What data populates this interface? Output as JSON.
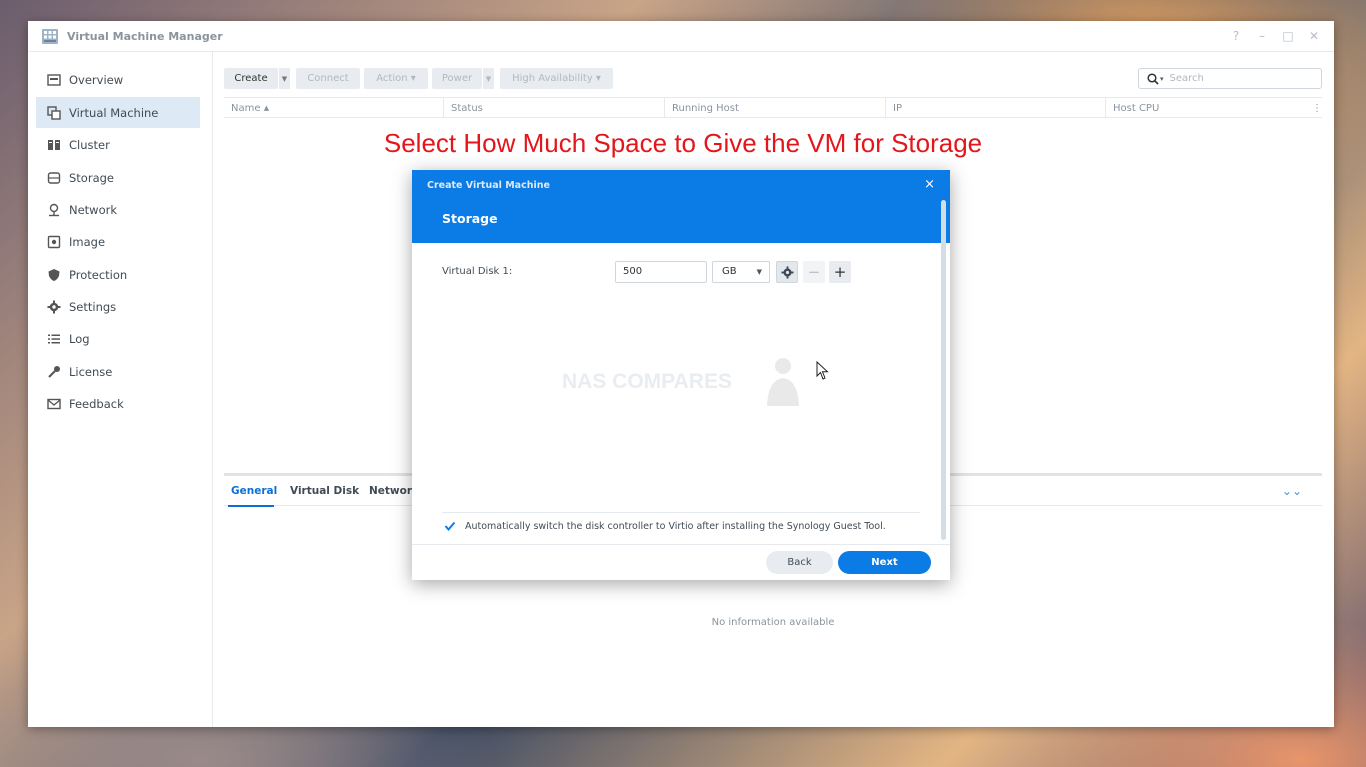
{
  "window": {
    "title": "Virtual Machine Manager",
    "controls": [
      "?",
      "–",
      "□",
      "✕"
    ]
  },
  "sidebar": {
    "items": [
      {
        "label": "Overview",
        "icon": "overview-icon",
        "active": false
      },
      {
        "label": "Virtual Machine",
        "icon": "virtual-machine-icon",
        "active": true
      },
      {
        "label": "Cluster",
        "icon": "cluster-icon",
        "active": false
      },
      {
        "label": "Storage",
        "icon": "storage-icon",
        "active": false
      },
      {
        "label": "Network",
        "icon": "network-icon",
        "active": false
      },
      {
        "label": "Image",
        "icon": "image-icon",
        "active": false
      },
      {
        "label": "Protection",
        "icon": "protection-icon",
        "active": false
      },
      {
        "label": "Settings",
        "icon": "gear-icon",
        "active": false
      },
      {
        "label": "Log",
        "icon": "log-icon",
        "active": false
      },
      {
        "label": "License",
        "icon": "key-icon",
        "active": false
      },
      {
        "label": "Feedback",
        "icon": "mail-icon",
        "active": false
      }
    ]
  },
  "toolbar": {
    "create": "Create",
    "connect": "Connect",
    "action": "Action",
    "power": "Power",
    "high_availability": "High Availability"
  },
  "search": {
    "placeholder": "Search"
  },
  "grid": {
    "columns": [
      "Name",
      "Status",
      "Running Host",
      "IP",
      "Host CPU"
    ]
  },
  "annotation": "Select How Much Space to Give the VM for Storage",
  "bottom_panel": {
    "tabs": [
      "General",
      "Virtual Disk",
      "Network"
    ],
    "empty_text": "No information available"
  },
  "modal": {
    "title": "Create Virtual Machine",
    "close": "×",
    "step": "Storage",
    "disk_label": "Virtual Disk 1:",
    "disk_size": "500",
    "disk_unit": "GB",
    "watermark": "NAS COMPARES",
    "checkbox_label": "Automatically switch the disk controller to Virtio after installing the Synology Guest Tool.",
    "checkbox_checked": true,
    "back": "Back",
    "next": "Next"
  },
  "colors": {
    "accent": "#0b7be6",
    "annotation": "#e4161b",
    "sidebar_active": "#dde9f5"
  }
}
